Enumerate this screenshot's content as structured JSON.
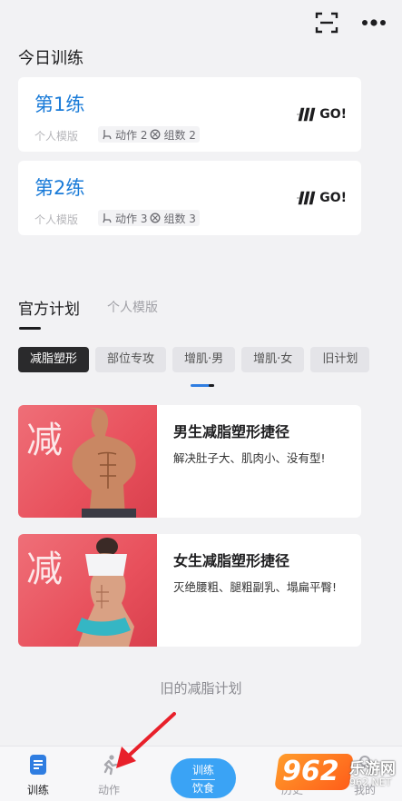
{
  "today": {
    "title": "今日训练",
    "cards": [
      {
        "name": "第1练",
        "mode": "个人模版",
        "actions": "动作 2",
        "groups": "组数 2",
        "go": "GO!"
      },
      {
        "name": "第2练",
        "mode": "个人模版",
        "actions": "动作 3",
        "groups": "组数 3",
        "go": "GO!"
      }
    ]
  },
  "plans": {
    "tabs": [
      "官方计划",
      "个人模版"
    ],
    "active_tab": "官方计划",
    "chips": [
      "减脂塑形",
      "部位专攻",
      "增肌·男",
      "增肌·女",
      "旧计划"
    ],
    "active_chip": "减脂塑形",
    "items": [
      {
        "thumb_char": "减",
        "title": "男生减脂塑形捷径",
        "desc": "解决肚子大、肌肉小、没有型!"
      },
      {
        "thumb_char": "减",
        "title": "女生减脂塑形捷径",
        "desc": "灭绝腰粗、腿粗副乳、塌扁平臀!"
      }
    ],
    "old_link": "旧的减脂计划"
  },
  "nav": {
    "items": [
      {
        "label": "训练",
        "icon": "document-icon",
        "active": true
      },
      {
        "label": "动作",
        "icon": "running-icon",
        "active": false
      },
      {
        "label": "历史",
        "icon": "history-icon",
        "active": false
      },
      {
        "label": "我的",
        "icon": "profile-icon",
        "active": false
      }
    ],
    "center_top": "训练",
    "center_bottom": "饮食"
  },
  "watermark": {
    "num": "962",
    "cn": "乐游网",
    "url": "962.NET"
  },
  "colors": {
    "accent": "#1a7bd8",
    "chip_active": "#2a2a2c",
    "center_btn": "#3aa3f5",
    "thumb": "#e8505c",
    "arrow": "#e8202a"
  }
}
